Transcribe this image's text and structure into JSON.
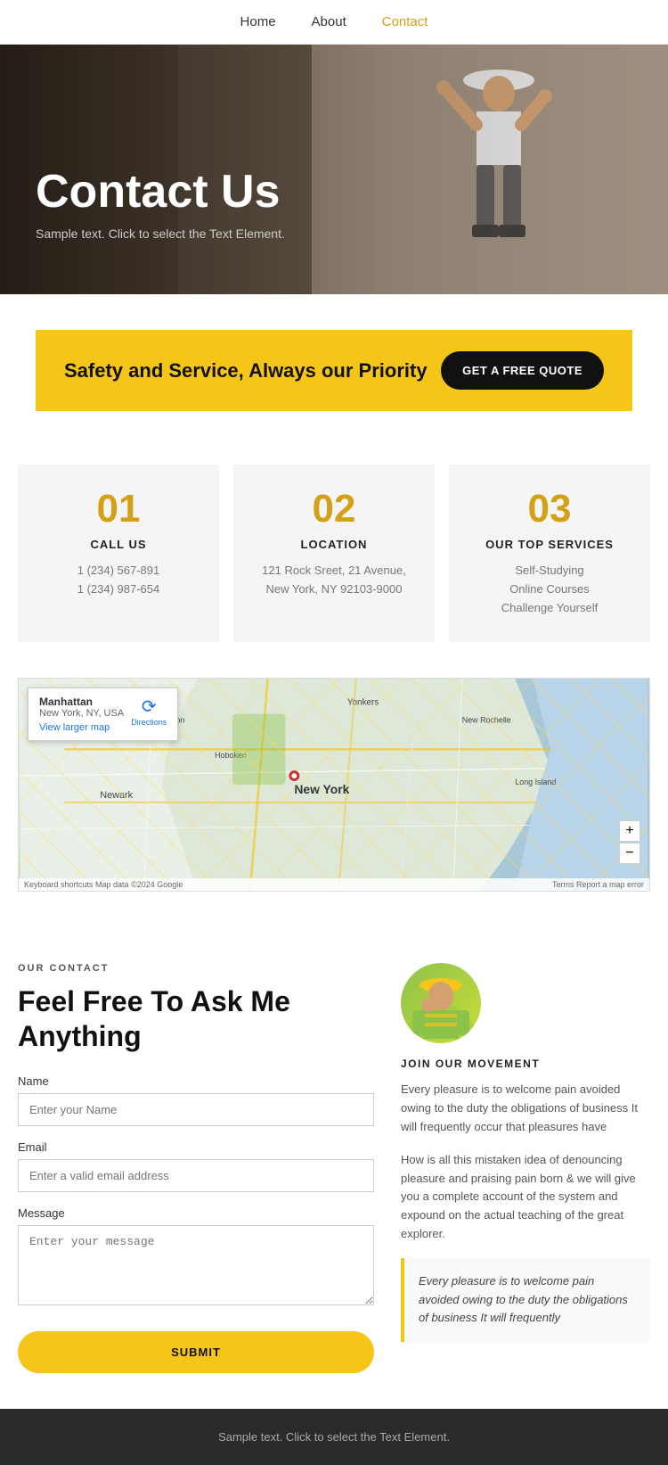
{
  "nav": {
    "items": [
      {
        "label": "Home",
        "active": false
      },
      {
        "label": "About",
        "active": false
      },
      {
        "label": "Contact",
        "active": true
      }
    ]
  },
  "hero": {
    "title": "Contact Us",
    "subtitle": "Sample text. Click to select the Text Element."
  },
  "banner": {
    "text": "Safety and Service, Always our Priority",
    "button_label": "GET A FREE QUOTE"
  },
  "cards": [
    {
      "number": "01",
      "title": "CALL US",
      "lines": [
        "1 (234) 567-891",
        "1 (234) 987-654"
      ]
    },
    {
      "number": "02",
      "title": "LOCATION",
      "lines": [
        "121 Rock Sreet, 21 Avenue,",
        "New York, NY 92103-9000"
      ]
    },
    {
      "number": "03",
      "title": "OUR TOP SERVICES",
      "lines": [
        "Self-Studying",
        "Online Courses",
        "Challenge Yourself"
      ]
    }
  ],
  "map": {
    "popup_title": "Manhattan",
    "popup_sub": "New York, NY, USA",
    "popup_link": "View larger map",
    "directions_label": "Directions",
    "label_newark": "Newark",
    "label_newyork": "New York",
    "label_yonkers": "Yonkers",
    "footer_left": "Keyboard shortcuts   Map data ©2024 Google",
    "footer_right": "Terms   Report a map error",
    "zoom_in": "+",
    "zoom_out": "−"
  },
  "contact_section": {
    "our_contact_label": "OUR CONTACT",
    "heading": "Feel Free To Ask Me Anything",
    "form": {
      "name_label": "Name",
      "name_placeholder": "Enter your Name",
      "email_label": "Email",
      "email_placeholder": "Enter a valid email address",
      "message_label": "Message",
      "message_placeholder": "Enter your message",
      "submit_label": "SUBMIT"
    },
    "right": {
      "join_label": "JOIN OUR MOVEMENT",
      "para1": "Every pleasure is to welcome pain avoided owing to the duty the obligations of business It will frequently occur that pleasures have",
      "para2": "How is all this mistaken idea of denouncing pleasure and praising pain born & we will give you a complete account of the system and expound on the actual teaching of the great explorer.",
      "quote": "Every pleasure is to welcome pain avoided owing to the duty the obligations of business It will frequently"
    }
  },
  "footer": {
    "text": "Sample text. Click to select the Text Element."
  }
}
